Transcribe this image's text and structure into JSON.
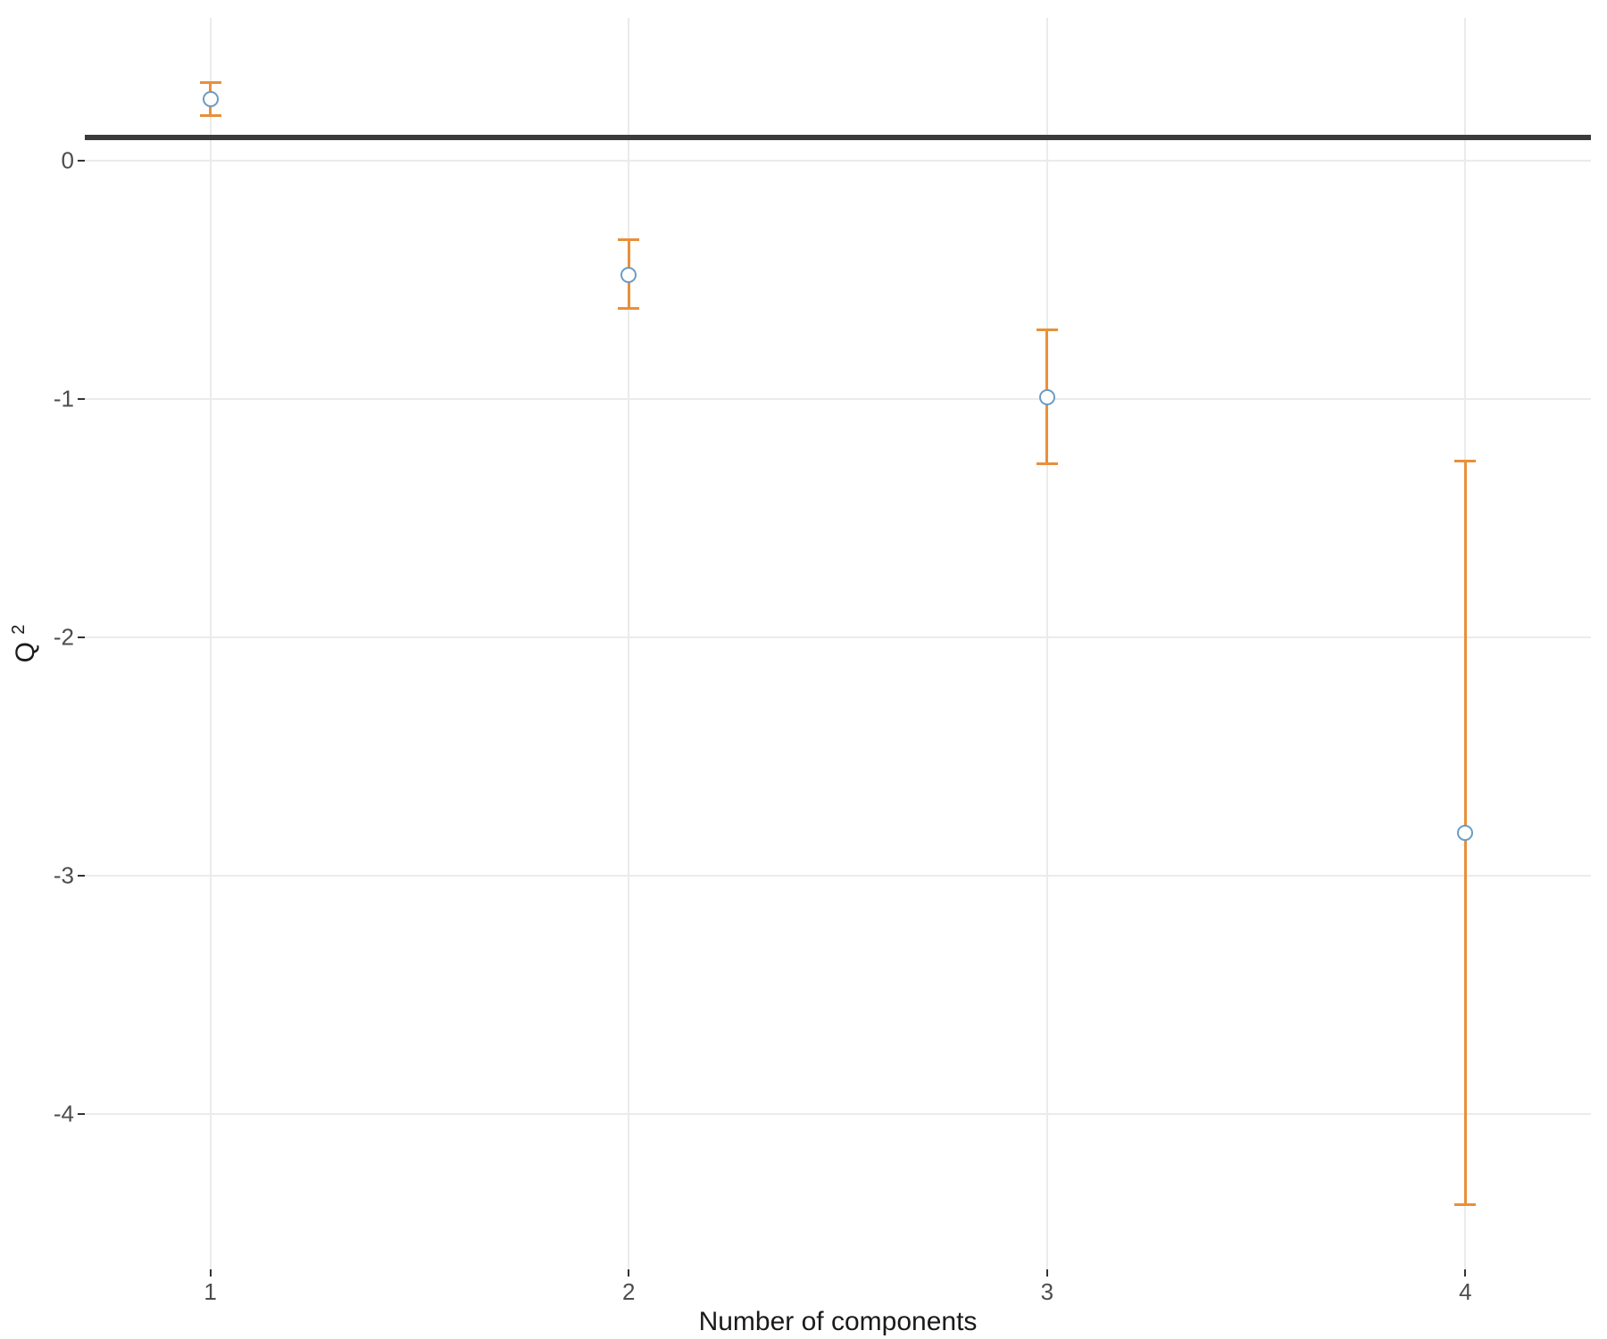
{
  "chart_data": {
    "type": "scatter",
    "title": "",
    "xlabel": "Number of components",
    "ylabel": "Q²",
    "xlim": [
      0.7,
      4.3
    ],
    "ylim": [
      -4.65,
      0.6
    ],
    "x_ticks": [
      1,
      2,
      3,
      4
    ],
    "y_ticks": [
      -4,
      -3,
      -2,
      -1,
      0
    ],
    "hline": 0.0975,
    "series": [
      {
        "name": "Q2",
        "x": [
          1,
          2,
          3,
          4
        ],
        "y": [
          0.26,
          -0.48,
          -0.99,
          -2.82
        ],
        "err_low": [
          0.19,
          -0.62,
          -1.27,
          -4.38
        ],
        "err_high": [
          0.33,
          -0.33,
          -0.71,
          -1.26
        ]
      }
    ],
    "colors": {
      "point_stroke": "#6b9bc4",
      "point_fill": "#ffffff",
      "error_bar": "#e8903b",
      "hline": "#3b3b3b",
      "grid": "#ebebeb"
    }
  }
}
